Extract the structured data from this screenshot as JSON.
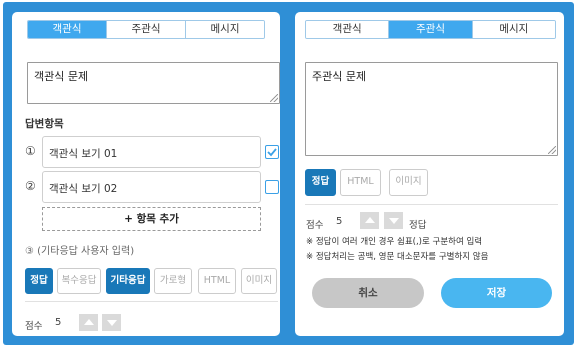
{
  "left": {
    "tabs": [
      "객관식",
      "주관식",
      "메시지"
    ],
    "question_text": "객관식 문제",
    "answers_heading": "답변항목",
    "options": [
      {
        "num": "①",
        "text": "객관식 보기 01",
        "checked": true
      },
      {
        "num": "②",
        "text": "객관식 보기 02",
        "checked": false
      }
    ],
    "add_item_label": "+ 항목 추가",
    "etc_label": "③ (기타응답 사용자 입력)",
    "buttons": {
      "correct": "정답",
      "multiple": "복수응답",
      "etc": "기타응답",
      "horizontal": "가로형",
      "html": "HTML",
      "image": "이미지"
    },
    "score_label": "점수",
    "score_value": "5"
  },
  "right": {
    "tabs": [
      "객관식",
      "주관식",
      "메시지"
    ],
    "question_text": "주관식 문제",
    "buttons": {
      "correct": "정답",
      "html": "HTML",
      "image": "이미지"
    },
    "score_label": "점수",
    "score_value": "5",
    "score_suffix": "정답",
    "notes": [
      "※ 정답이 여러 개인 경우 쉼표(,)로 구분하여 입력",
      "※ 정답처리는 공백, 영문 대소문자를 구별하지 않음"
    ],
    "cancel_label": "취소",
    "save_label": "저장"
  },
  "colors": {
    "frame": "#2f8fd6",
    "tab_active": "#3fa8ee",
    "primary_button": "#1978b8",
    "save_button": "#49b6f0",
    "cancel_button": "#c7c7c7"
  }
}
